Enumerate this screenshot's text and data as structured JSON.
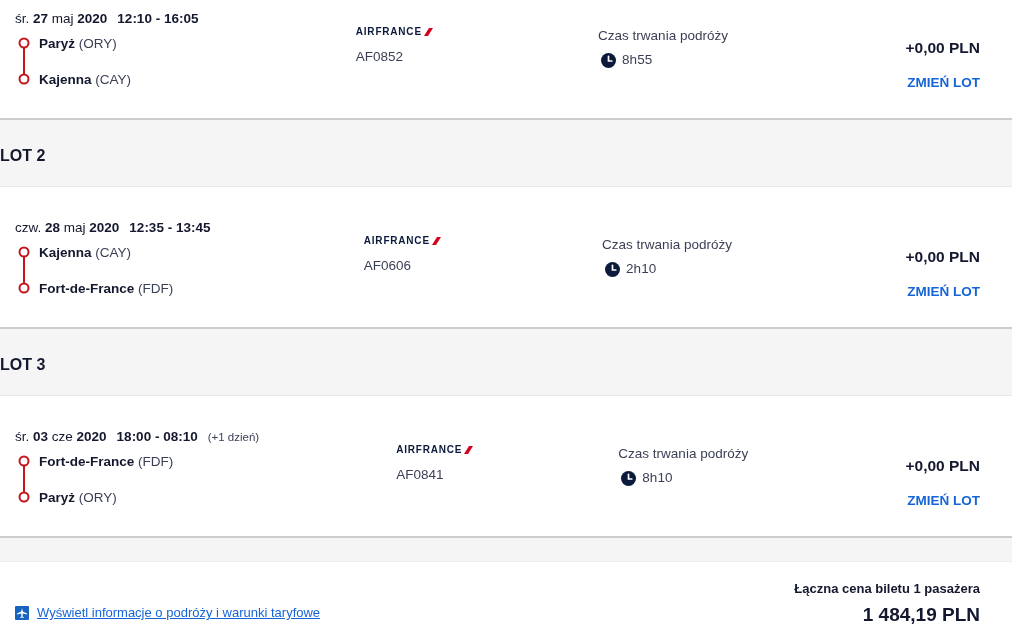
{
  "segments": [
    {
      "flight": {
        "date": "śr. **27** maj **2020**",
        "times": "12:10 - 16:05",
        "origin": "**Paryż** (ORY)",
        "destination": "**Kajenna** (CAY)",
        "airline": "AIRFRANCE",
        "flight_number": "AF0852",
        "duration_label": "Czas trwania podróży",
        "duration": "8h55",
        "price": "+0,00 PLN",
        "action": "ZMIEŃ LOT"
      }
    },
    {
      "label": "LOT 2",
      "flight": {
        "date": "czw. **28** maj **2020**",
        "times": "12:35 - 13:45",
        "origin": "**Kajenna** (CAY)",
        "destination": "**Fort-de-France** (FDF)",
        "airline": "AIRFRANCE",
        "flight_number": "AF0606",
        "duration_label": "Czas trwania podróży",
        "duration": "2h10",
        "price": "+0,00 PLN",
        "action": "ZMIEŃ LOT"
      }
    },
    {
      "label": "LOT 3",
      "flight": {
        "date": "śr. **03** cze **2020**",
        "times": "18:00 - 08:10",
        "day_note": "(+1 dzień)",
        "origin": "**Fort-de-France** (FDF)",
        "destination": "**Paryż** (ORY)",
        "airline": "AIRFRANCE",
        "flight_number": "AF0841",
        "duration_label": "Czas trwania podróży",
        "duration": "8h10",
        "price": "+0,00 PLN",
        "action": "ZMIEŃ LOT"
      }
    }
  ],
  "footer": {
    "link": "Wyświetl informacje o podróży i warunki taryfowe",
    "total_label": "Łączna cena biletu 1 pasażera",
    "total": "1 484,19 PLN"
  }
}
